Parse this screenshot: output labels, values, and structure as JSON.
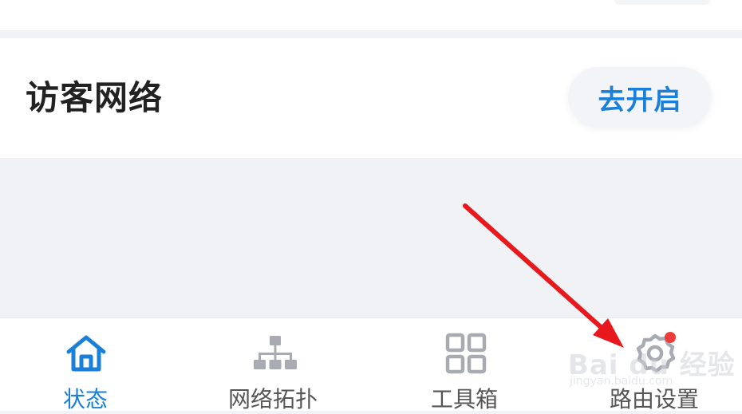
{
  "guest_network": {
    "title": "访客网络",
    "enable_label": "去开启"
  },
  "tabbar": {
    "tabs": [
      {
        "label": "状态",
        "icon": "home-icon",
        "active": true
      },
      {
        "label": "网络拓扑",
        "icon": "topology-icon",
        "active": false
      },
      {
        "label": "工具箱",
        "icon": "grid-icon",
        "active": false
      },
      {
        "label": "路由设置",
        "icon": "gear-icon",
        "active": false,
        "badge": true
      }
    ]
  },
  "watermark": {
    "brand": "Bai du 经验",
    "url": "jingyan.baidu.com"
  },
  "colors": {
    "accent": "#1a7fd9",
    "text_dark": "#222222",
    "text_muted": "#555555",
    "icon_gray": "#a8acb2",
    "badge": "#ee3b3b",
    "annotation_arrow": "#e8191c",
    "background": "#f1f2f5"
  }
}
